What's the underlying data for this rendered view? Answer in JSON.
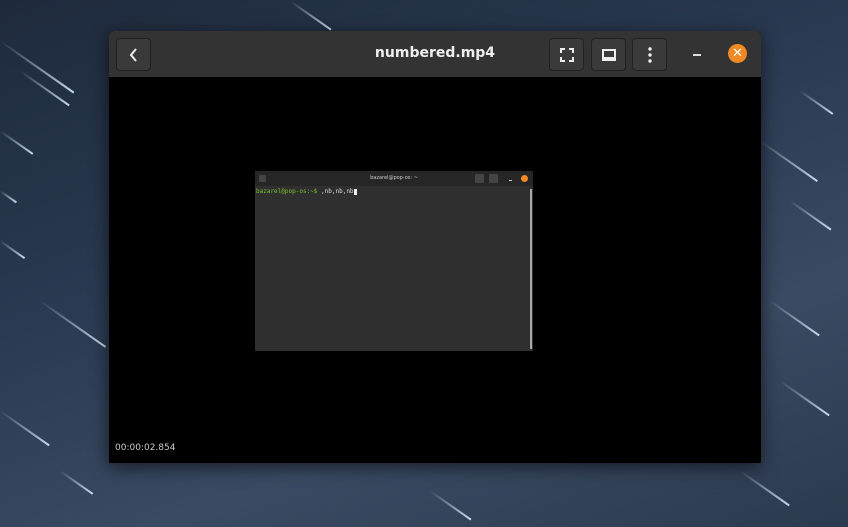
{
  "window": {
    "title": "numbered.mp4",
    "timestamp": "00:00:02.854"
  },
  "icons": {
    "back": "chevron-left-icon",
    "fullscreen": "fullscreen-icon",
    "subtitles": "subtitles-icon",
    "menu": "kebab-menu-icon",
    "minimize": "minimize-icon",
    "close": "close-icon"
  },
  "video_frame": {
    "terminal_title": "bazarel@pop-os: ~",
    "prompt": "bazarel@pop-os:~$",
    "command": " ,nb,nb,nb"
  },
  "colors": {
    "accent": "#f08a24",
    "header": "#333333",
    "prompt": "#7ac22a"
  }
}
